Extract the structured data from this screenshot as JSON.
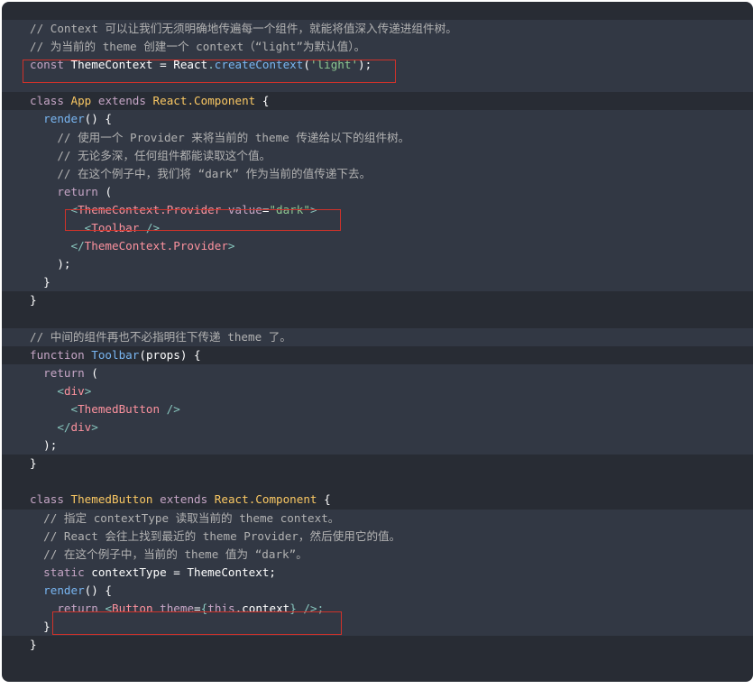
{
  "accent_colors": {
    "background": "#282c34",
    "highlight_line": "#323844",
    "annotation_box": "#d0322a"
  },
  "code": {
    "l1_comment": "// Context 可以让我们无须明确地传遍每一个组件，就能将值深入传递进组件树。",
    "l2_comment": "// 为当前的 theme 创建一个 context（“light”为默认值）。",
    "l3_const": "const",
    "l3_name": "ThemeContext",
    "l3_eq": " = ",
    "l3_react": "React",
    "l3_dot": ".",
    "l3_fn": "createContext",
    "l3_open": "(",
    "l3_str": "'light'",
    "l3_close": ");",
    "l5_class": "class",
    "l5_name": "App",
    "l5_extends": "extends",
    "l5_super": "React.Component",
    "l5_brace": "{",
    "l6_fn": "render",
    "l6_rest": "() {",
    "l7_comment": "// 使用一个 Provider 来将当前的 theme 传递给以下的组件树。",
    "l8_comment": "// 无论多深，任何组件都能读取这个值。",
    "l9_comment": "// 在这个例子中，我们将 “dark” 作为当前的值传递下去。",
    "l10_return": "return",
    "l10_paren": "(",
    "l11_lt": "<",
    "l11_tag": "ThemeContext.Provider",
    "l11_attr": "value",
    "l11_eq": "=",
    "l11_str": "\"dark\"",
    "l11_gt": ">",
    "l12_lt": "<",
    "l12_tag": "Toolbar",
    "l12_end": " />",
    "l13_lt": "</",
    "l13_tag": "ThemeContext.Provider",
    "l13_gt": ">",
    "l14_close": ");",
    "l15_close": "}",
    "l16_close": "}",
    "l18_comment": "// 中间的组件再也不必指明往下传递 theme 了。",
    "l19_function": "function",
    "l19_name": "Toolbar",
    "l19_open": "(",
    "l19_param": "props",
    "l19_close": ") {",
    "l20_return": "return",
    "l20_paren": "(",
    "l21_lt": "<",
    "l21_tag": "div",
    "l21_gt": ">",
    "l22_lt": "<",
    "l22_tag": "ThemedButton",
    "l22_end": " />",
    "l23_lt": "</",
    "l23_tag": "div",
    "l23_gt": ">",
    "l24_close": ");",
    "l25_close": "}",
    "l27_class": "class",
    "l27_name": "ThemedButton",
    "l27_extends": "extends",
    "l27_super": "React.Component",
    "l27_brace": "{",
    "l28_comment": "// 指定 contextType 读取当前的 theme context。",
    "l29_comment": "// React 会往上找到最近的 theme Provider，然后使用它的值。",
    "l30_comment": "// 在这个例子中，当前的 theme 值为 “dark”。",
    "l31_static": "static",
    "l31_prop": "contextType",
    "l31_eq": " = ",
    "l31_val": "ThemeContext",
    "l31_semi": ";",
    "l32_fn": "render",
    "l32_rest": "() {",
    "l33_return": "return",
    "l33_lt": "<",
    "l33_tag": "Button",
    "l33_attr": "theme",
    "l33_eq": "=",
    "l33_expr_open": "{",
    "l33_this": "this",
    "l33_dot": ".",
    "l33_ctx": "context",
    "l33_expr_close": "}",
    "l33_end": " />;",
    "l34_close": "}",
    "l35_close": "}"
  }
}
